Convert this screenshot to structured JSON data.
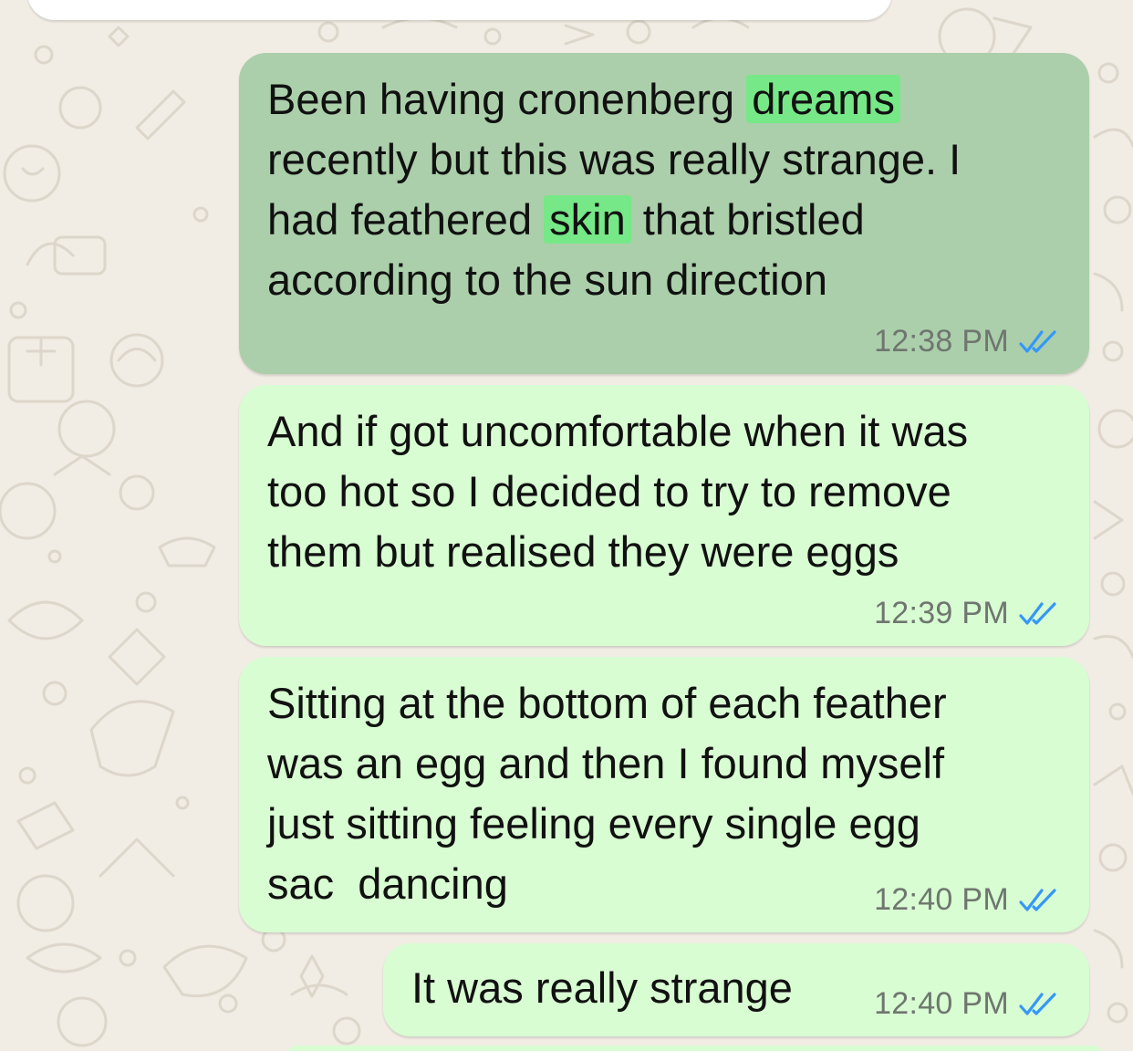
{
  "messages": [
    {
      "id": "m1",
      "segments": [
        {
          "text": "Been having cronenberg "
        },
        {
          "text": "dreams",
          "highlight": true
        },
        {
          "text": "\nrecently but this was really strange. I\nhad feathered "
        },
        {
          "text": "skin",
          "highlight": true
        },
        {
          "text": " that bristled\naccording to the sun direction"
        }
      ],
      "time": "12:38 PM",
      "status": "read",
      "selected": true
    },
    {
      "id": "m2",
      "text": "And if got uncomfortable when it was\ntoo hot so I decided to try to remove\nthem but realised they were eggs",
      "time": "12:39 PM",
      "status": "read"
    },
    {
      "id": "m3",
      "text": "Sitting at the bottom of each feather\nwas an egg and then I found myself\njust sitting feeling every single egg\nsac  dancing",
      "time": "12:40 PM",
      "status": "read"
    },
    {
      "id": "m4",
      "text": "It was really strange",
      "time": "12:40 PM",
      "status": "read"
    }
  ],
  "icons": {
    "read_receipt": "double-check-icon"
  },
  "colors": {
    "wallpaper": "#f1ece4",
    "wallpaper_doodle": "#ddd6ca",
    "outgoing_bubble": "#d8fdd2",
    "selected_bubble": "#abcfaa",
    "search_highlight": "#76e887",
    "read_tick": "#3497f9",
    "timestamp": "#6f766f"
  }
}
